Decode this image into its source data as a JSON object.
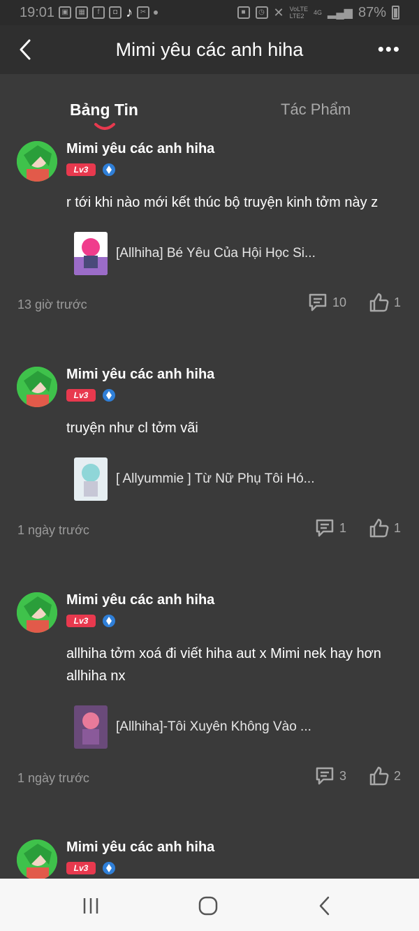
{
  "status_bar": {
    "time": "19:01",
    "battery": "87%",
    "net_top": "VoLTE",
    "net_bottom": "LTE2",
    "signal_label": "4G"
  },
  "header": {
    "title": "Mimi yêu các anh hiha",
    "back_icon": "chevron-left-icon",
    "menu_icon": "more-horizontal-icon"
  },
  "tabs": [
    {
      "label": "Bảng Tin",
      "active": true
    },
    {
      "label": "Tác Phẩm",
      "active": false
    }
  ],
  "posts": [
    {
      "author": "Mimi yêu các anh hiha",
      "level": "Lv3",
      "content": "r tới khi nào mới kết thúc bộ truyện kinh tởm này z",
      "story_title": "[Allhiha] Bé Yêu Của Hội Học Si...",
      "time": "13 giờ trước",
      "comments": "10",
      "likes": "1"
    },
    {
      "author": "Mimi yêu các anh hiha",
      "level": "Lv3",
      "content": "truyện như cl tởm vãi",
      "story_title": "[ Allyummie ] Từ Nữ Phụ Tôi Hó...",
      "time": "1 ngày trước",
      "comments": "1",
      "likes": "1"
    },
    {
      "author": "Mimi yêu các anh hiha",
      "level": "Lv3",
      "content": "allhiha tởm xoá đi viết hiha aut x Mimi nek hay hơn allhiha nx",
      "story_title": "[Allhiha]-Tôi Xuyên Không Vào ...",
      "time": "1 ngày trước",
      "comments": "3",
      "likes": "2"
    },
    {
      "author": "Mimi yêu các anh hiha",
      "level": "Lv3"
    }
  ],
  "colors": {
    "background": "#3a3a3a",
    "header": "#2f2f2f",
    "accent": "#e8394e",
    "level_badge": "#e8394e",
    "muted_text": "#9b9b9b"
  }
}
